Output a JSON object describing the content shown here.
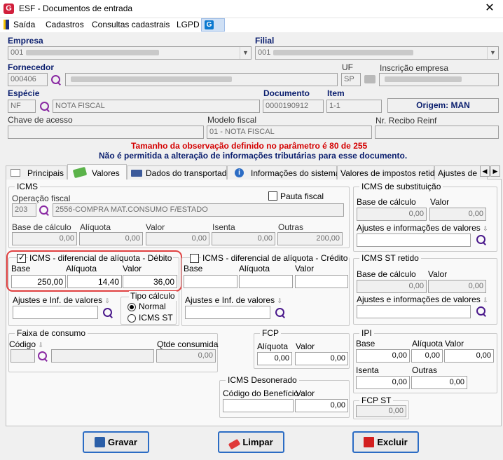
{
  "window": {
    "title": "ESF - Documentos de entrada",
    "close": "✕",
    "logo": "G"
  },
  "menu": {
    "items": [
      "Saída",
      "Cadastros",
      "Consultas cadastrais",
      "LGPD"
    ]
  },
  "header": {
    "empresa_label": "Empresa",
    "empresa_value": "001",
    "filial_label": "Filial",
    "filial_value": "001",
    "fornecedor_label": "Fornecedor",
    "fornecedor_value": "000406",
    "uf_label": "UF",
    "uf_value": "SP",
    "inscricao_label": "Inscrição empresa",
    "especie_label": "Espécie",
    "especie_code": "NF",
    "especie_desc": "NOTA FISCAL",
    "documento_label": "Documento",
    "documento_value": "0000190912",
    "item_label": "Item",
    "item_value": "1-1",
    "origem": "Origem: MAN",
    "chave_label": "Chave de acesso",
    "modelo_label": "Modelo fiscal",
    "modelo_value": "01 - NOTA FISCAL",
    "recibo_label": "Nr. Recibo Reinf"
  },
  "messages": {
    "warning": "Tamanho da observação definido no parâmetro é 80 de 255",
    "info": "Não é permitida a alteração de informações tributárias para esse documento."
  },
  "tabs": [
    "Principais",
    "Valores",
    "Dados do transportador",
    "Informações do sistema",
    "Valores de impostos retidos",
    "Ajustes de C"
  ],
  "icms": {
    "title": "ICMS",
    "op_label": "Operação fiscal",
    "op_code": "203",
    "op_desc": "2556-COMPRA MAT.CONSUMO F/ESTADO",
    "pauta_label": "Pauta fiscal",
    "base_label": "Base de cálculo",
    "aliquota_label": "Alíquota",
    "valor_label": "Valor",
    "isenta_label": "Isenta",
    "outras_label": "Outras",
    "base": "0,00",
    "aliquota": "0,00",
    "valor": "0,00",
    "isenta": "0,00",
    "outras": "200,00"
  },
  "difal_debito": {
    "title": "ICMS - diferencial de alíquota - Débito",
    "base_label": "Base",
    "aliquota_label": "Alíquota",
    "valor_label": "Valor",
    "base": "250,00",
    "aliquota": "14,40",
    "valor": "36,00",
    "ajustes_label": "Ajustes e Inf. de valores",
    "tipo_label": "Tipo cálculo",
    "normal": "Normal",
    "icmsst": "ICMS ST"
  },
  "difal_credito": {
    "title": "ICMS - diferencial de alíquota - Crédito",
    "base_label": "Base",
    "aliquota_label": "Alíquota",
    "valor_label": "Valor",
    "ajustes_label": "Ajustes e Inf. de valores"
  },
  "icms_st": {
    "title": "ICMS de substituição",
    "base_label": "Base de cálculo",
    "valor_label": "Valor",
    "base": "0,00",
    "valor": "0,00",
    "ajustes_label": "Ajustes e informações de valores"
  },
  "icms_st_retido": {
    "title": "ICMS ST retido",
    "base_label": "Base de cálculo",
    "valor_label": "Valor",
    "base": "0,00",
    "valor": "0,00",
    "ajustes_label": "Ajustes e informações de valores"
  },
  "faixa": {
    "title": "Faixa de consumo",
    "codigo_label": "Código",
    "qtde_label": "Qtde consumida",
    "qtde": "0,00"
  },
  "fcp": {
    "title": "FCP",
    "aliquota_label": "Alíquota",
    "valor_label": "Valor",
    "aliquota": "0,00",
    "valor": "0,00"
  },
  "ipi": {
    "title": "IPI",
    "base_label": "Base",
    "aliquota_label": "Alíquota",
    "valor_label": "Valor",
    "isenta_label": "Isenta",
    "outras_label": "Outras",
    "base": "0,00",
    "aliquota": "0,00",
    "valor": "0,00",
    "isenta": "0,00",
    "outras": "0,00"
  },
  "desonerado": {
    "title": "ICMS Desonerado",
    "codigo_label": "Código do Benefício",
    "valor_label": "Valor",
    "valor": "0,00"
  },
  "fcp_st": {
    "title": "FCP ST",
    "valor": "0,00"
  },
  "buttons": {
    "gravar": "Gravar",
    "limpar": "Limpar",
    "excluir": "Excluir"
  },
  "colors": {
    "accent": "#2b6cc4",
    "highlight": "#e04040",
    "warning": "#d40000",
    "label": "#0a1e6e"
  }
}
